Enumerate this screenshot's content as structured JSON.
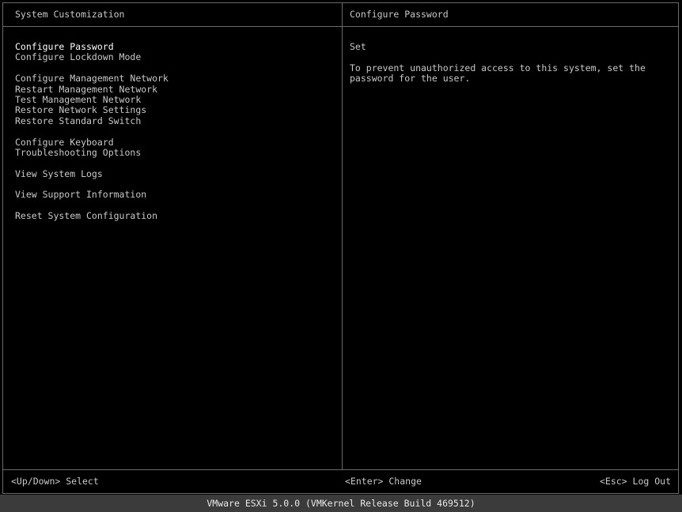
{
  "left_panel": {
    "title": "System Customization",
    "menu": [
      [
        "Configure Password",
        "Configure Lockdown Mode"
      ],
      [
        "Configure Management Network",
        "Restart Management Network",
        "Test Management Network",
        "Restore Network Settings",
        "Restore Standard Switch"
      ],
      [
        "Configure Keyboard",
        "Troubleshooting Options"
      ],
      [
        "View System Logs"
      ],
      [
        "View Support Information"
      ],
      [
        "Reset System Configuration"
      ]
    ],
    "selected_item": "Configure Password"
  },
  "right_panel": {
    "title": "Configure Password",
    "status": "Set",
    "description_lines": [
      "To prevent unauthorized access to this system, set the",
      "password for the user."
    ]
  },
  "footer": {
    "select_hint": "<Up/Down> Select",
    "change_hint": "<Enter> Change",
    "logout_hint": "<Esc> Log Out"
  },
  "statusbar": {
    "text": "VMware ESXi 5.0.0 (VMKernel Release Build 469512)"
  },
  "colors": {
    "background": "#000000",
    "text": "#c8c8c8",
    "rule": "#6a6a6a",
    "statusbar_bg": "#3b3b3b"
  }
}
